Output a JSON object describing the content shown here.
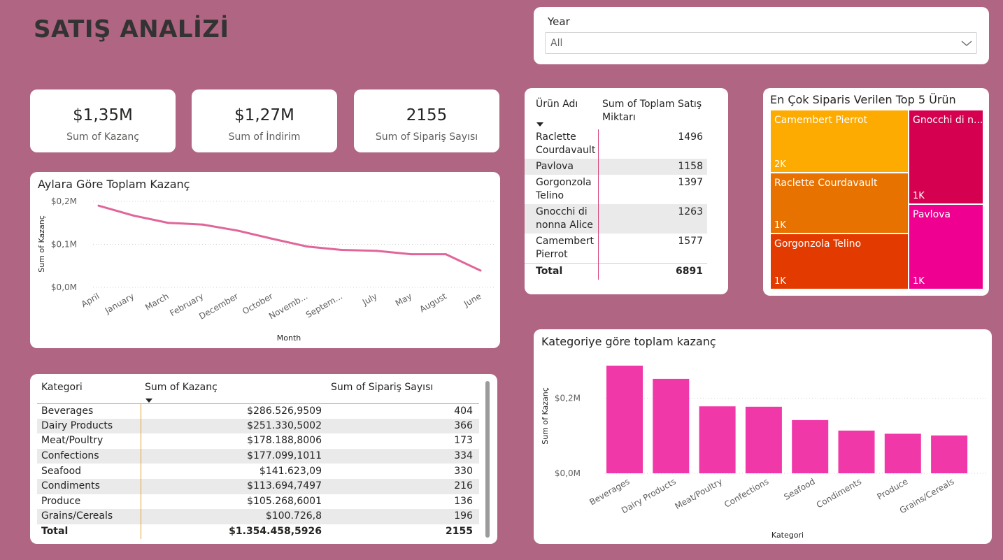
{
  "page_title": "SATIŞ ANALİZİ",
  "slicer": {
    "label": "Year",
    "value": "All"
  },
  "kpis": [
    {
      "value": "$1,35M",
      "label": "Sum of Kazanç"
    },
    {
      "value": "$1,27M",
      "label": "Sum of İndirim"
    },
    {
      "value": "2155",
      "label": "Sum of Sipariş Sayısı"
    }
  ],
  "line_chart": {
    "title": "Aylara Göre Toplam Kazanç",
    "color": "#e06699",
    "chart_data": {
      "type": "line",
      "title": "Aylara Göre Toplam Kazanç",
      "xlabel": "Month",
      "ylabel": "Sum of Kazanç",
      "categories": [
        "April",
        "January",
        "March",
        "February",
        "December",
        "October",
        "Novemb...",
        "Septem...",
        "July",
        "May",
        "August",
        "June"
      ],
      "values": [
        0.19,
        0.167,
        0.15,
        0.146,
        0.132,
        0.113,
        0.095,
        0.087,
        0.085,
        0.077,
        0.077,
        0.039
      ],
      "yticks": [
        "$0,0M",
        "$0,1M",
        "$0,2M"
      ],
      "ylim": [
        0,
        0.2
      ],
      "grid": true
    }
  },
  "product_table": {
    "headers": [
      "Ürün Adı",
      "Sum of Toplam Satış Miktarı"
    ],
    "rows": [
      {
        "name": "Raclette Courdavault",
        "value": "1496"
      },
      {
        "name": "Pavlova",
        "value": "1158"
      },
      {
        "name": "Gorgonzola Telino",
        "value": "1397"
      },
      {
        "name": "Gnocchi di nonna Alice",
        "value": "1263"
      },
      {
        "name": "Camembert Pierrot",
        "value": "1577"
      }
    ],
    "total_label": "Total",
    "total_value": "6891"
  },
  "treemap": {
    "title": "En Çok Siparis Verilen Top 5 Ürün",
    "tiles": [
      {
        "label": "Camembert Pierrot",
        "value": "2K",
        "color": "#fdab00"
      },
      {
        "label": "Gnocchi di n...",
        "value": "1K",
        "color": "#d5004f"
      },
      {
        "label": "Raclette Courdavault",
        "value": "1K",
        "color": "#e87200"
      },
      {
        "label": "Pavlova",
        "value": "1K",
        "color": "#ef0090"
      },
      {
        "label": "Gorgonzola Telino",
        "value": "1K",
        "color": "#e33a00"
      }
    ]
  },
  "category_table": {
    "headers": [
      "Kategori",
      "Sum of Kazanç",
      "Sum of Sipariş Sayısı"
    ],
    "rows": [
      {
        "kategori": "Beverages",
        "kazanc": "$286.526,9509",
        "siparis": "404"
      },
      {
        "kategori": "Dairy Products",
        "kazanc": "$251.330,5002",
        "siparis": "366"
      },
      {
        "kategori": "Meat/Poultry",
        "kazanc": "$178.188,8006",
        "siparis": "173"
      },
      {
        "kategori": "Confections",
        "kazanc": "$177.099,1011",
        "siparis": "334"
      },
      {
        "kategori": "Seafood",
        "kazanc": "$141.623,09",
        "siparis": "330"
      },
      {
        "kategori": "Condiments",
        "kazanc": "$113.694,7497",
        "siparis": "216"
      },
      {
        "kategori": "Produce",
        "kazanc": "$105.268,6001",
        "siparis": "136"
      },
      {
        "kategori": "Grains/Cereals",
        "kazanc": "$100.726,8",
        "siparis": "196"
      }
    ],
    "total": {
      "kategori": "Total",
      "kazanc": "$1.354.458,5926",
      "siparis": "2155"
    }
  },
  "bar_chart": {
    "title": "Kategoriye göre toplam kazanç",
    "color": "#f038a8",
    "chart_data": {
      "type": "bar",
      "title": "Kategoriye göre toplam kazanç",
      "xlabel": "Kategori",
      "ylabel": "Sum of Kazanç",
      "categories": [
        "Beverages",
        "Dairy Products",
        "Meat/Poultry",
        "Confections",
        "Seafood",
        "Condiments",
        "Produce",
        "Grains/Cereals"
      ],
      "values": [
        286526.95,
        251330.5,
        178188.8,
        177099.1,
        141623.09,
        113694.75,
        105268.6,
        100726.8
      ],
      "yticks": [
        "$0,0M",
        "$0,2M"
      ],
      "ylim": [
        0,
        320000
      ],
      "grid": true
    }
  },
  "icons": {
    "dropdown": "chevron-down-icon",
    "sort": "sort-desc-icon"
  }
}
